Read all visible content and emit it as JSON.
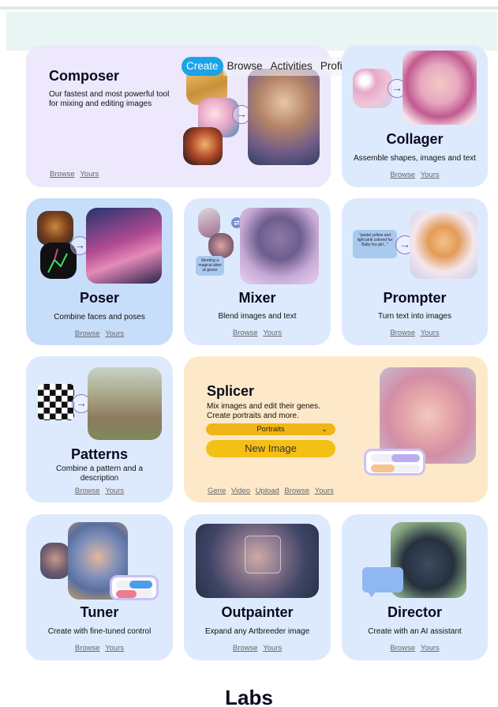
{
  "nav": {
    "items": [
      "Create",
      "Browse",
      "Activities",
      "Profile"
    ],
    "active": "Create"
  },
  "colors": {
    "nav_active": "#1aa3e8",
    "card_blue": "#ddeafd",
    "card_lavender": "#ede8fb",
    "card_cream": "#fde9c9",
    "button_yellow": "#f5c016",
    "title_ink": "#0a0a1e"
  },
  "tools": {
    "composer": {
      "title": "Composer",
      "desc": "Our fastest and most powerful tool for mixing and editing images",
      "links": [
        "Browse",
        "Yours"
      ]
    },
    "collager": {
      "title": "Collager",
      "desc": "Assemble shapes, images and text",
      "links": [
        "Browse",
        "Yours"
      ]
    },
    "poser": {
      "title": "Poser",
      "desc": "Combine faces and poses",
      "links": [
        "Browse",
        "Yours"
      ]
    },
    "mixer": {
      "title": "Mixer",
      "desc": "Blend images and text",
      "links": [
        "Browse",
        "Yours"
      ],
      "thumb_text": "Meeting a magical alien at gesso"
    },
    "prompter": {
      "title": "Prompter",
      "desc": "Turn text into images",
      "links": [
        "Browse",
        "Yours"
      ],
      "prompt_text": "\"pastel yellow and light pink colored fur Baby fox girl...\""
    },
    "patterns": {
      "title": "Patterns",
      "desc": "Combine a pattern and a description",
      "links": [
        "Browse",
        "Yours"
      ]
    },
    "splicer": {
      "title": "Splicer",
      "desc": "Mix images and edit their genes. Create portraits and more.",
      "dropdown_value": "Portraits",
      "new_image_label": "New Image",
      "links": [
        "Gene",
        "Video",
        "Upload",
        "Browse",
        "Yours"
      ]
    },
    "tuner": {
      "title": "Tuner",
      "desc": "Create with fine-tuned control",
      "links": [
        "Browse",
        "Yours"
      ]
    },
    "outpainter": {
      "title": "Outpainter",
      "desc": "Expand any Artbreeder image",
      "links": [
        "Browse",
        "Yours"
      ]
    },
    "director": {
      "title": "Director",
      "desc": "Create with an AI assistant",
      "links": [
        "Browse",
        "Yours"
      ]
    }
  },
  "icons": [
    "arrow-right-icon",
    "chevron-down-icon",
    "chat-bubble-icon",
    "toggle-sliders-icon",
    "shuffle-icon"
  ],
  "section_heading": "Labs"
}
